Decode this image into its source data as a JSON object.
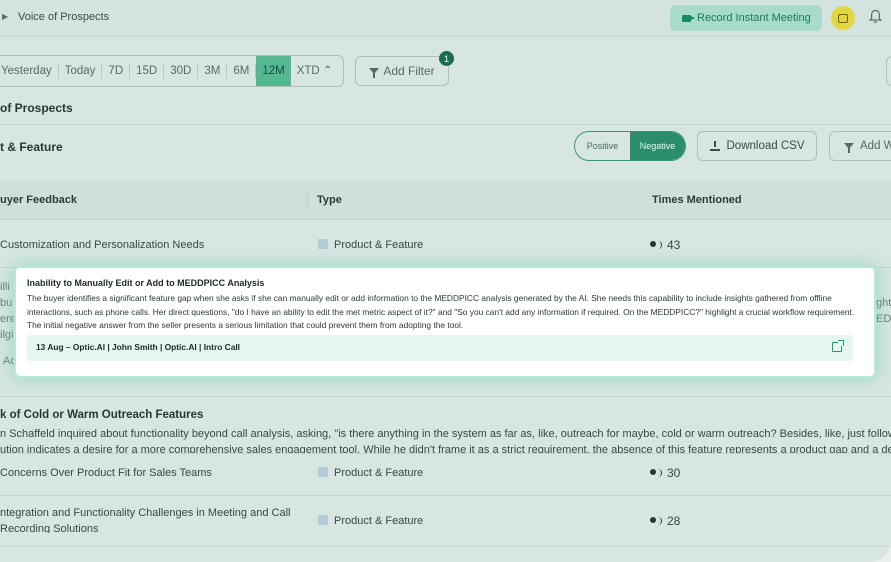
{
  "header": {
    "breadcrumb": "Voice of Prospects",
    "record_button": "Record Instant Meeting"
  },
  "filters": {
    "date_ranges": [
      "Yesterday",
      "Today",
      "7D",
      "15D",
      "30D",
      "3M",
      "6M",
      "12M",
      "XTD"
    ],
    "active_range": "12M",
    "xtd_suffix": "⌃",
    "add_filter": "Add Filter",
    "filter_count": "1"
  },
  "section": {
    "title": "of Prospects",
    "subtitle": "t & Feature"
  },
  "toolbar": {
    "positive": "Positive",
    "negative": "Negative",
    "download_csv": "Download CSV",
    "add_widget": "Add W"
  },
  "table": {
    "headers": [
      "uyer Feedback",
      "Type",
      "Times Mentioned"
    ],
    "rows": [
      {
        "feedback": "Customization and Personalization Needs",
        "type": "Product & Feature",
        "count": "43"
      },
      {
        "feedback": "Concerns Over Product Fit for Sales Teams",
        "type": "Product & Feature",
        "count": "30"
      },
      {
        "feedback": "ntegration and Functionality Challenges in Meeting and Call",
        "feedback_line2": "Recording Solutions",
        "type": "Product & Feature",
        "count": "28"
      }
    ]
  },
  "ghost_rows": {
    "left1": "illi",
    "left2": "bu",
    "left3": "ere",
    "left4": "ilgi",
    "left5": "Ac",
    "right1": "ght",
    "right2": "ED"
  },
  "expanded": {
    "title": "k of Cold or Warm Outreach Features",
    "text_line1": "n Schaffeld inquired about functionality beyond call analysis, asking, \"is there anything in the system as far as, like, outreach for maybe, cold or warm outreach? Besides, like, just follow-up em",
    "text_line2": "ution indicates a desire for a more comprehensive sales engagement tool. While he didn't frame it as a strict requirement, the absence of this feature represents a product gap and a desired ca"
  },
  "popup": {
    "title": "Inability to Manually Edit or Add to MEDDPICC Analysis",
    "body": "The buyer identifies a significant feature gap when she asks if she can manually edit or add information to the MEDDPICC analysis generated by the AI. She needs this capability to include insights gathered from offline interactions, such as phone calls. Her direct questions, \"do I have an ability to edit the met metric aspect of it?\" and \"So you can't add any information if required. On the MEDDPICC?\" highlight a crucial workflow requirement. The initial negative answer from the seller presents a serious limitation that could prevent them from adopting the tool.",
    "call_label": "13 Aug – Optic.AI | John Smith | Optic.AI | Intro Call"
  },
  "colors": {
    "accent": "#2a8e6c",
    "active_range_bg": "#55b892",
    "record_bg": "#a8dbc9",
    "chat_bg": "#e2d73c"
  },
  "icons": [
    "video-camera-icon",
    "chat-icon",
    "bell-icon",
    "funnel-icon",
    "download-icon",
    "speaker-icon",
    "external-link-icon"
  ]
}
